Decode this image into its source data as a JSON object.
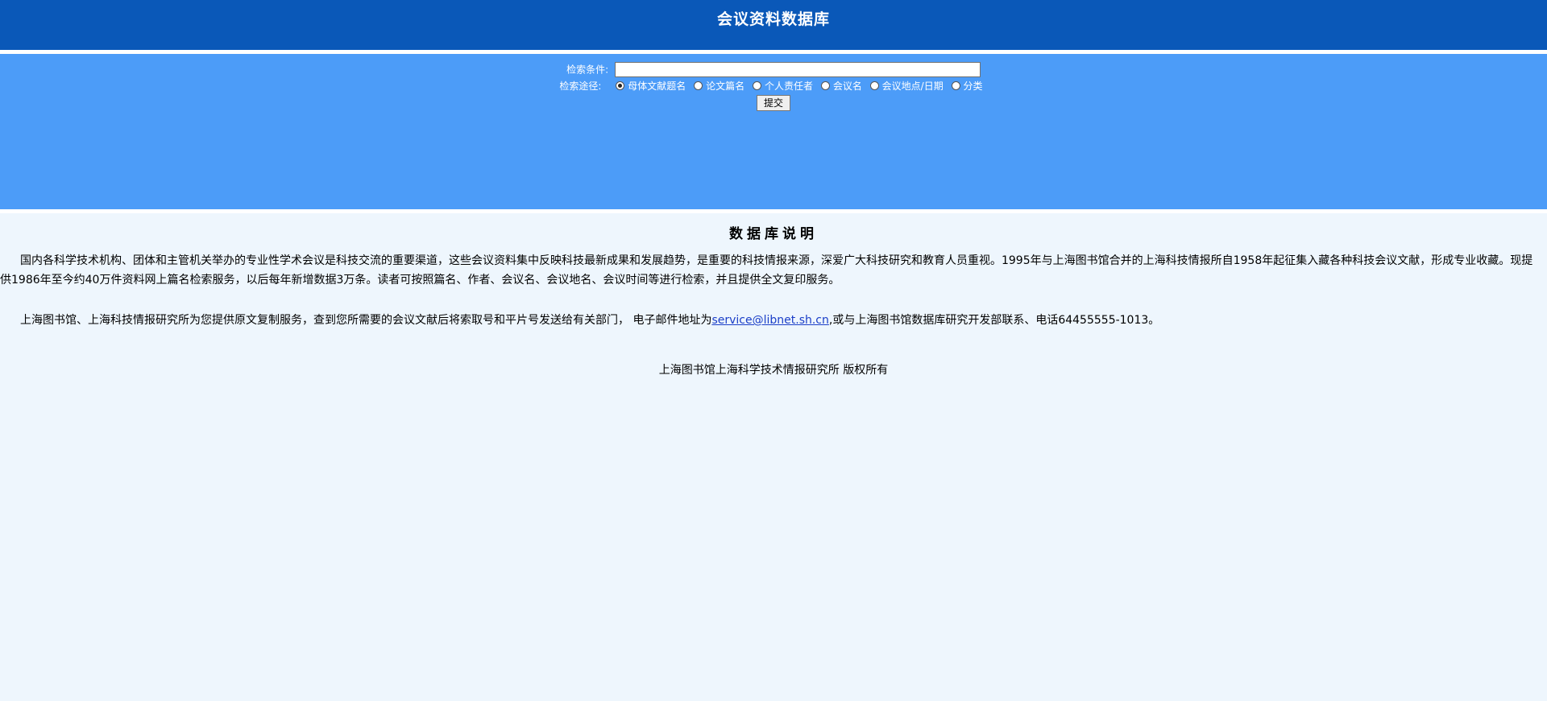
{
  "header": {
    "title": "会议资料数据库"
  },
  "search": {
    "keyword_label": "检索条件:",
    "keyword_value": "",
    "path_label": "检索途径:",
    "options": [
      {
        "label": "母体文献题名",
        "checked": true
      },
      {
        "label": "论文篇名",
        "checked": false
      },
      {
        "label": "个人责任者",
        "checked": false
      },
      {
        "label": "会议名",
        "checked": false
      },
      {
        "label": "会议地点/日期",
        "checked": false
      },
      {
        "label": "分类",
        "checked": false
      }
    ],
    "submit_label": "提交"
  },
  "description": {
    "title": "数据库说明",
    "paragraph1": "国内各科学技术机构、团体和主管机关举办的专业性学术会议是科技交流的重要渠道，这些会议资料集中反映科技最新成果和发展趋势，是重要的科技情报来源，深爱广大科技研究和教育人员重视。1995年与上海图书馆合并的上海科技情报所自1958年起征集入藏各种科技会议文献，形成专业收藏。现提供1986年至今约40万件资料网上篇名检索服务，以后每年新增数据3万条。读者可按照篇名、作者、会议名、会议地名、会议时间等进行检索，并且提供全文复印服务。",
    "paragraph2_before": "上海图书馆、上海科技情报研究所为您提供原文复制服务，查到您所需要的会议文献后将索取号和平片号发送给有关部门， 电子邮件地址为",
    "email": "service@libnet.sh.cn",
    "paragraph2_after": ",或与上海图书馆数据库研究开发部联系、电话64455555-1013。"
  },
  "footer": {
    "copyright": "上海图书馆上海科学技术情报研究所  版权所有"
  },
  "colors": {
    "header_bg": "#0a58b8",
    "search_bg": "#4c9cf8",
    "page_bg": "#eef6fd",
    "link": "#1a3ec8"
  }
}
